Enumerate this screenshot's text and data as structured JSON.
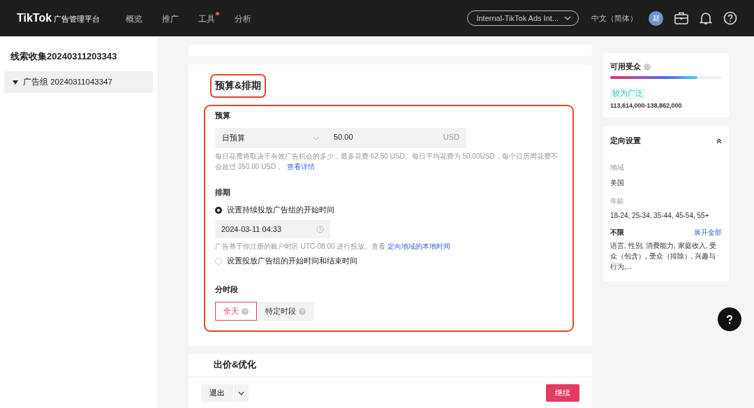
{
  "topbar": {
    "logo": "TikTok",
    "logo_suffix": "广告管理平台",
    "nav": [
      {
        "label": "概览",
        "dot": false
      },
      {
        "label": "推广",
        "dot": false
      },
      {
        "label": "工具",
        "dot": true
      },
      {
        "label": "分析",
        "dot": false
      }
    ],
    "account": "Internal-TikTok Ads Int...",
    "language": "中文（简体）",
    "avatar": "赵"
  },
  "sidebar": {
    "campaign": "线索收集20240311203343",
    "items": [
      {
        "label": "广告组 20240311043347",
        "expanded": true,
        "selected": true
      }
    ]
  },
  "section": {
    "title": "预算&排期",
    "budget": {
      "label": "预算",
      "type": "日预算",
      "amount": "50.00",
      "currency": "USD",
      "hint": "每日花费将取决于有效广告机会的多少，最多花费 62.50 USD。每日平均花费为 50.00USD，每个日历周花费不会超过 350.00 USD 。",
      "hint_link": "查看详情"
    },
    "schedule": {
      "label": "排期",
      "options": [
        {
          "label": "设置持续投放广告组的开始时间",
          "selected": true,
          "start_time": "2024-03-11 04:33",
          "note": "广告基于你注册的账户时区 UTC-08:00 进行投放。查看",
          "note_link": "定向地域的本地时间"
        },
        {
          "label": "设置投放广告组的开始时间和结束时间",
          "selected": false
        }
      ]
    },
    "dayparting": {
      "label": "分时段",
      "options": [
        {
          "label": "全天",
          "selected": true
        },
        {
          "label": "特定时段",
          "selected": false
        }
      ]
    }
  },
  "next_section": {
    "title": "出价&优化"
  },
  "audience": {
    "title": "可用受众",
    "level": 0.78,
    "badge": "较为广泛",
    "range": "113,614,000-138,862,000"
  },
  "targeting": {
    "title": "定向设置",
    "expanded": true,
    "fields": [
      {
        "label": "地域",
        "value": "美国"
      },
      {
        "label": "年龄",
        "value": "18-24, 25-34, 35-44, 45-54, 55+"
      }
    ],
    "unlimited": {
      "label": "不限",
      "link": "展开全部",
      "value": "语言, 性别, 消费能力, 家庭收入, 受众（包含）, 受众（排除）, 兴趣与行为,..."
    }
  },
  "footer": {
    "exit": "退出",
    "continue": "继续"
  }
}
